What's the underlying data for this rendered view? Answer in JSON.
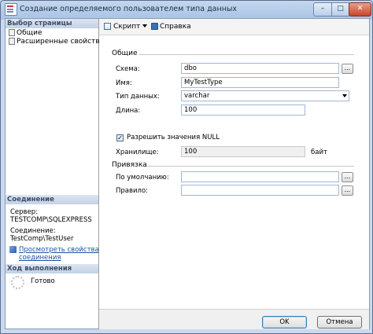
{
  "window": {
    "title": "Создание определяемого пользователем типа данных"
  },
  "left_pane": {
    "pages_header": "Выбор страницы",
    "pages": [
      "Общие",
      "Расширенные свойства"
    ],
    "connection_header": "Соединение",
    "server_label": "Сервер:",
    "server_value": "TESTCOMP\\SQLEXPRESS",
    "connection_label": "Соединение:",
    "connection_value": "TestComp\\TestUser",
    "view_props_link_line1": "Просмотреть свойства",
    "view_props_link_line2": "соединения",
    "progress_header": "Ход выполнения",
    "progress_status": "Готово"
  },
  "toolbar": {
    "script_label": "Скрипт",
    "help_label": "Справка"
  },
  "general": {
    "group_title": "Общие",
    "schema_label": "Схема:",
    "schema_value": "dbo",
    "name_label": "Имя:",
    "name_value": "MyTestType",
    "datatype_label": "Тип данных:",
    "datatype_value": "varchar",
    "length_label": "Длина:",
    "length_value": "100",
    "allow_null_label": "Разрешить значения NULL",
    "allow_null_checked": true,
    "storage_label": "Хранилище:",
    "storage_value": "100",
    "storage_unit": "байт"
  },
  "binding": {
    "group_title": "Привязка",
    "default_label": "По умолчанию:",
    "default_value": "",
    "rule_label": "Правило:",
    "rule_value": ""
  },
  "buttons": {
    "ok": "OK",
    "cancel": "Отмена",
    "browse": "..."
  }
}
